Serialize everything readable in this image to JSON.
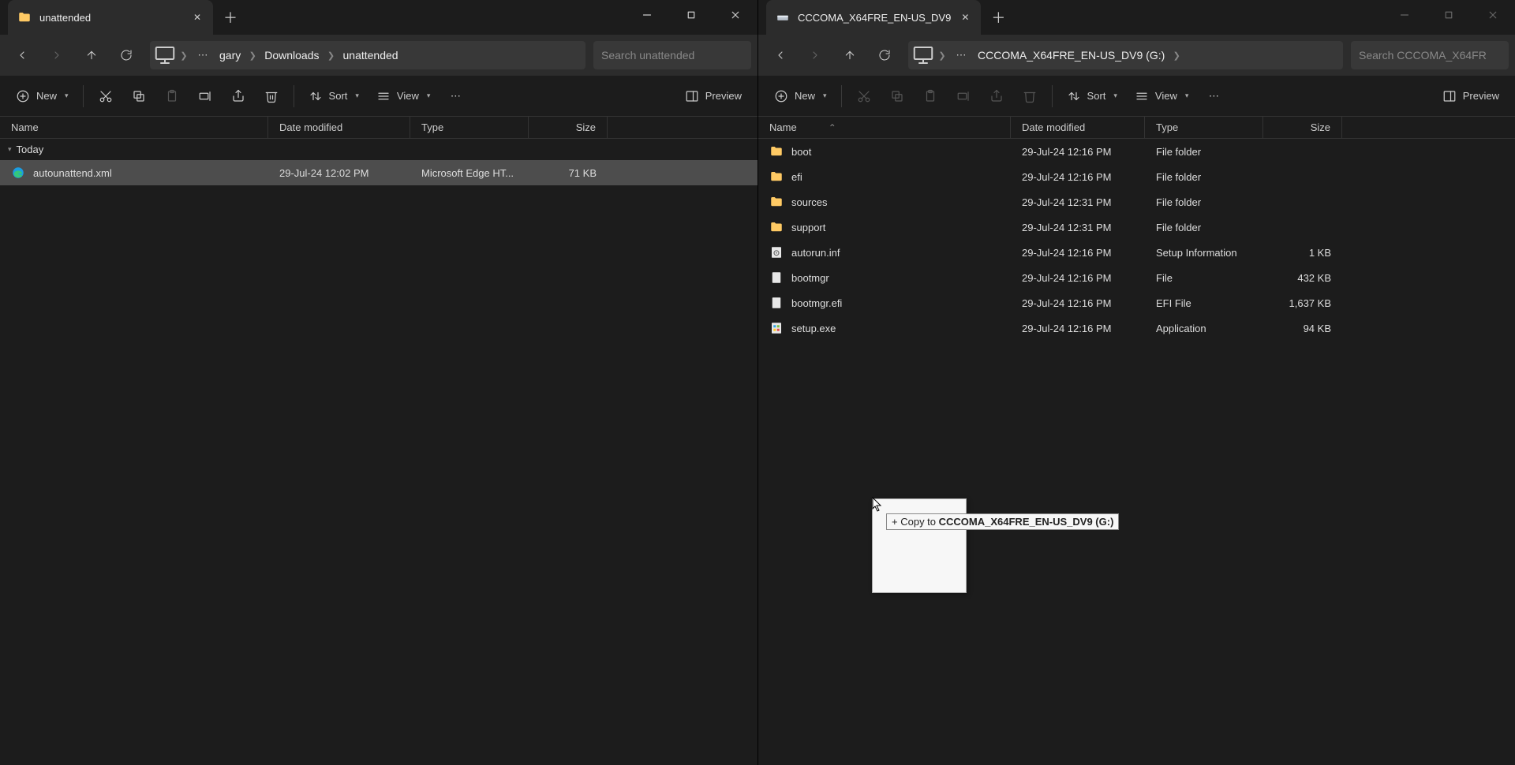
{
  "left": {
    "tab_title": "unattended",
    "breadcrumbs": [
      "gary",
      "Downloads",
      "unattended"
    ],
    "search_placeholder": "Search unattended",
    "toolbar": {
      "new": "New",
      "sort": "Sort",
      "view": "View",
      "preview": "Preview"
    },
    "columns": {
      "name": "Name",
      "date": "Date modified",
      "type": "Type",
      "size": "Size"
    },
    "group": "Today",
    "rows": [
      {
        "name": "autounattend.xml",
        "date": "29-Jul-24 12:02 PM",
        "type": "Microsoft Edge HT...",
        "size": "71 KB",
        "icon": "edge-file",
        "selected": true
      }
    ]
  },
  "right": {
    "tab_title": "CCCOMA_X64FRE_EN-US_DV9",
    "breadcrumbs": [
      "CCCOMA_X64FRE_EN-US_DV9 (G:)"
    ],
    "search_placeholder": "Search CCCOMA_X64FR",
    "toolbar": {
      "new": "New",
      "sort": "Sort",
      "view": "View",
      "preview": "Preview"
    },
    "columns": {
      "name": "Name",
      "date": "Date modified",
      "type": "Type",
      "size": "Size"
    },
    "rows": [
      {
        "name": "boot",
        "date": "29-Jul-24 12:16 PM",
        "type": "File folder",
        "size": "",
        "icon": "folder"
      },
      {
        "name": "efi",
        "date": "29-Jul-24 12:16 PM",
        "type": "File folder",
        "size": "",
        "icon": "folder"
      },
      {
        "name": "sources",
        "date": "29-Jul-24 12:31 PM",
        "type": "File folder",
        "size": "",
        "icon": "folder"
      },
      {
        "name": "support",
        "date": "29-Jul-24 12:31 PM",
        "type": "File folder",
        "size": "",
        "icon": "folder"
      },
      {
        "name": "autorun.inf",
        "date": "29-Jul-24 12:16 PM",
        "type": "Setup Information",
        "size": "1 KB",
        "icon": "inf"
      },
      {
        "name": "bootmgr",
        "date": "29-Jul-24 12:16 PM",
        "type": "File",
        "size": "432 KB",
        "icon": "file"
      },
      {
        "name": "bootmgr.efi",
        "date": "29-Jul-24 12:16 PM",
        "type": "EFI File",
        "size": "1,637 KB",
        "icon": "file"
      },
      {
        "name": "setup.exe",
        "date": "29-Jul-24 12:16 PM",
        "type": "Application",
        "size": "94 KB",
        "icon": "exe"
      }
    ]
  },
  "drag": {
    "tip_prefix": "Copy to ",
    "tip_target": "CCCOMA_X64FRE_EN-US_DV9 (G:)"
  }
}
